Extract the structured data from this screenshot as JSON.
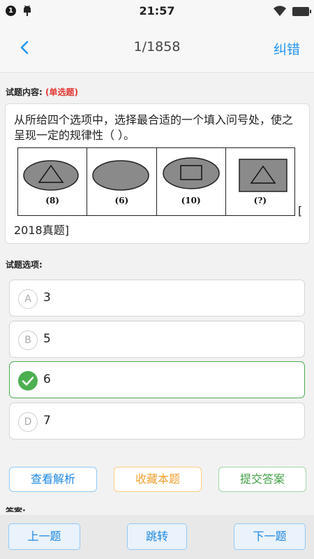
{
  "status_bar": {
    "notification_count": "1",
    "time": "21:57",
    "icons": [
      "notification-badge",
      "android-icon",
      "wifi-icon",
      "battery-icon"
    ]
  },
  "nav": {
    "back_icon": "chevron-left-icon",
    "title": "1/1858",
    "correct_label": "纠错"
  },
  "question": {
    "content_label": "试题内容:",
    "type": "(单选题)",
    "text": "从所给四个选项中，选择最合适的一个填入问号处，使之呈现一定的规律性（    ）。",
    "bracket": "[",
    "source": "2018真题]",
    "figures": [
      {
        "shape": "ellipse-with-triangle",
        "caption": "(8)"
      },
      {
        "shape": "ellipse",
        "caption": "(6)"
      },
      {
        "shape": "ellipse-with-rectangle",
        "caption": "(10)"
      },
      {
        "shape": "square-with-triangle",
        "caption": "(?)"
      }
    ]
  },
  "options_section": {
    "label": "试题选项:",
    "options": [
      {
        "letter": "A",
        "value": "3",
        "selected": false
      },
      {
        "letter": "B",
        "value": "5",
        "selected": false
      },
      {
        "letter": "C",
        "value": "6",
        "selected": true
      },
      {
        "letter": "D",
        "value": "7",
        "selected": false
      }
    ]
  },
  "actions": {
    "analysis": "查看解析",
    "favorite": "收藏本题",
    "submit": "提交答案"
  },
  "answer_label": "答案:",
  "bottom_nav": {
    "prev": "上一题",
    "jump": "跳转",
    "next": "下一题"
  },
  "colors": {
    "accent": "#2196f3",
    "selected": "#4caf50",
    "favorite": "#f0a030",
    "type_red": "#e53935"
  }
}
